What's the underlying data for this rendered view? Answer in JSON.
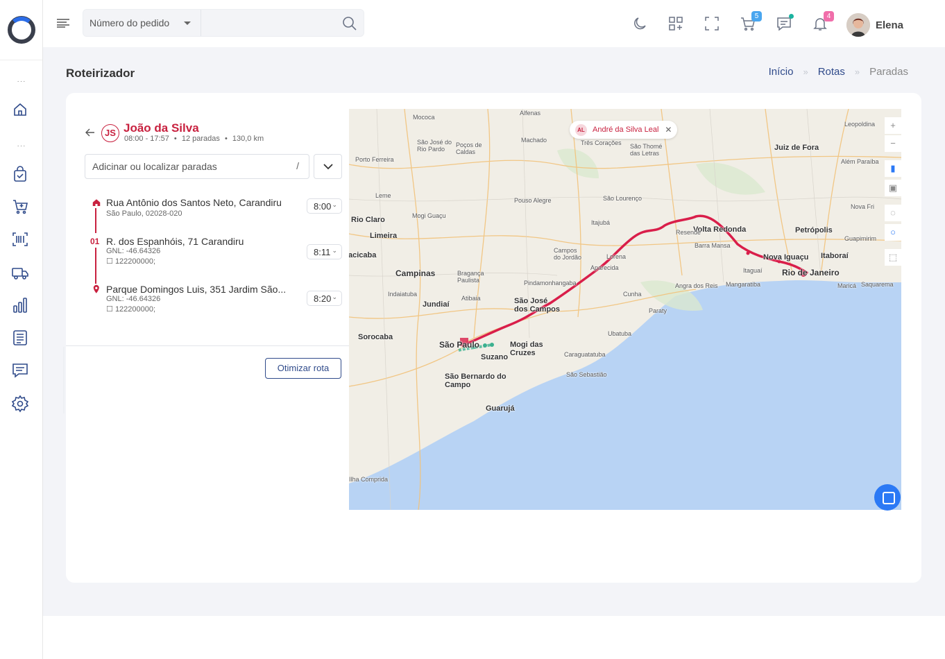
{
  "search": {
    "select_label": "Número do pedido",
    "placeholder": ""
  },
  "topbar": {
    "icons": [
      "moon-icon",
      "apps-add-icon",
      "fullscreen-icon",
      "cart-icon",
      "chat-icon",
      "bell-icon"
    ],
    "cart_badge": "5",
    "notif_badge": "4",
    "username": "Elena",
    "colors": {
      "cart_badge": "#4aa6ef",
      "notif_badge": "#f06eaa",
      "chat_dot": "#1bb3a0"
    }
  },
  "sidebar": {
    "icons": [
      "home-icon",
      "shopping-bag-check-icon",
      "cart-add-icon",
      "barcode-icon",
      "truck-icon",
      "bar-chart-icon",
      "document-list-icon",
      "message-icon",
      "settings-icon"
    ]
  },
  "page": {
    "title": "Roteirizador",
    "breadcrumb": [
      "Início",
      "Rotas",
      "Paradas"
    ]
  },
  "route": {
    "initials": "JS",
    "driver": "João da Silva",
    "hours": "08:00 - 17:57",
    "stops_count": "12 paradas",
    "distance": "130,0 km",
    "search_placeholder": "Adicinar ou localizar paradas",
    "search_shortcut": "/",
    "stops": [
      {
        "marker": "home",
        "title": "Rua Antônio dos Santos Neto, Carandiru",
        "line1": "São Paulo, 02028-020",
        "line2": "",
        "time": "8:00"
      },
      {
        "marker": "01",
        "title": "R. dos Espanhóis, 71 Carandiru",
        "line1": "GNL: -46.64326",
        "line2": "122200000;",
        "time": "8:11"
      },
      {
        "marker": "pin",
        "title": "Parque Domingos Luis, 351 Jardim São...",
        "line1": "GNL: -46.64326",
        "line2": "122200000;",
        "time": "8:20"
      }
    ],
    "optimize_label": "Otimizar rota",
    "accent": "#c8213f"
  },
  "map": {
    "chip_initials": "AL",
    "chip_name": "André da Silva Leal",
    "cities": {
      "sao_paulo": "São Paulo",
      "rio": "Rio de Janeiro",
      "campinas": "Campinas",
      "sjc": "São José dos Campos",
      "volta": "Volta Redonda",
      "nova": "Nova Iguaçu",
      "petropolis": "Petrópolis",
      "juiz": "Juiz de Fora",
      "sorocaba": "Sorocaba",
      "jundiai": "Jundiaí",
      "mogi": "Mogi das Cruzes",
      "suzano": "Suzano",
      "sbc": "São Bernardo do Campo",
      "guaruja": "Guarujá",
      "rio_claro": "Rio Claro",
      "limeira": "Limeira",
      "itaborai": "Itaboraí",
      "mococa": "Mococa",
      "alfenas": "Alfenas",
      "machado": "Machado",
      "tres": "Três Corações",
      "pouso": "Pouso Alegre",
      "sao_lourenco": "São Lourenço",
      "itajuba": "Itajubá",
      "resende": "Resende",
      "barra_mansa": "Barra Mansa",
      "pinda": "Pindamonhangaba",
      "aparecida": "Aparecida",
      "lorena": "Lorena",
      "cunha": "Cunha",
      "paraty": "Paraty",
      "angra": "Angra dos Reis",
      "mangaratiba": "Mangaratiba",
      "itaguai": "Itaguaí",
      "ubatuba": "Ubatuba",
      "caragua": "Caraguatatuba",
      "sao_sebastiao": "São Sebastião",
      "atibaia": "Atibaia",
      "braganca": "Bragança Paulista",
      "indaiatuba": "Indaiatuba",
      "leme": "Leme",
      "mogi_guacu": "Mogi Guaçu",
      "porto_ferreira": "Porto Ferreira",
      "leopoldina": "Leopoldina",
      "nova_friburgo": "Nova Fri",
      "guapimirim": "Guapimirim",
      "marica": "Maricá",
      "saquarema": "Saquarema",
      "alem_paraiba": "Além Paraíba",
      "ilha": "Ilha Comprida",
      "campos_jordao": "Campos do Jordão",
      "sao_thome": "São Thomé das Letras",
      "sao_jose_rio_pardo": "São José do Rio Pardo",
      "pocos": "Poços de Caldas",
      "piracicaba": "acicaba"
    },
    "colors": {
      "water": "#b8d3f4",
      "land": "#f1eee6",
      "route": "#d91e4a",
      "green": "#3bb08f",
      "roads": "#f2c27a"
    }
  }
}
